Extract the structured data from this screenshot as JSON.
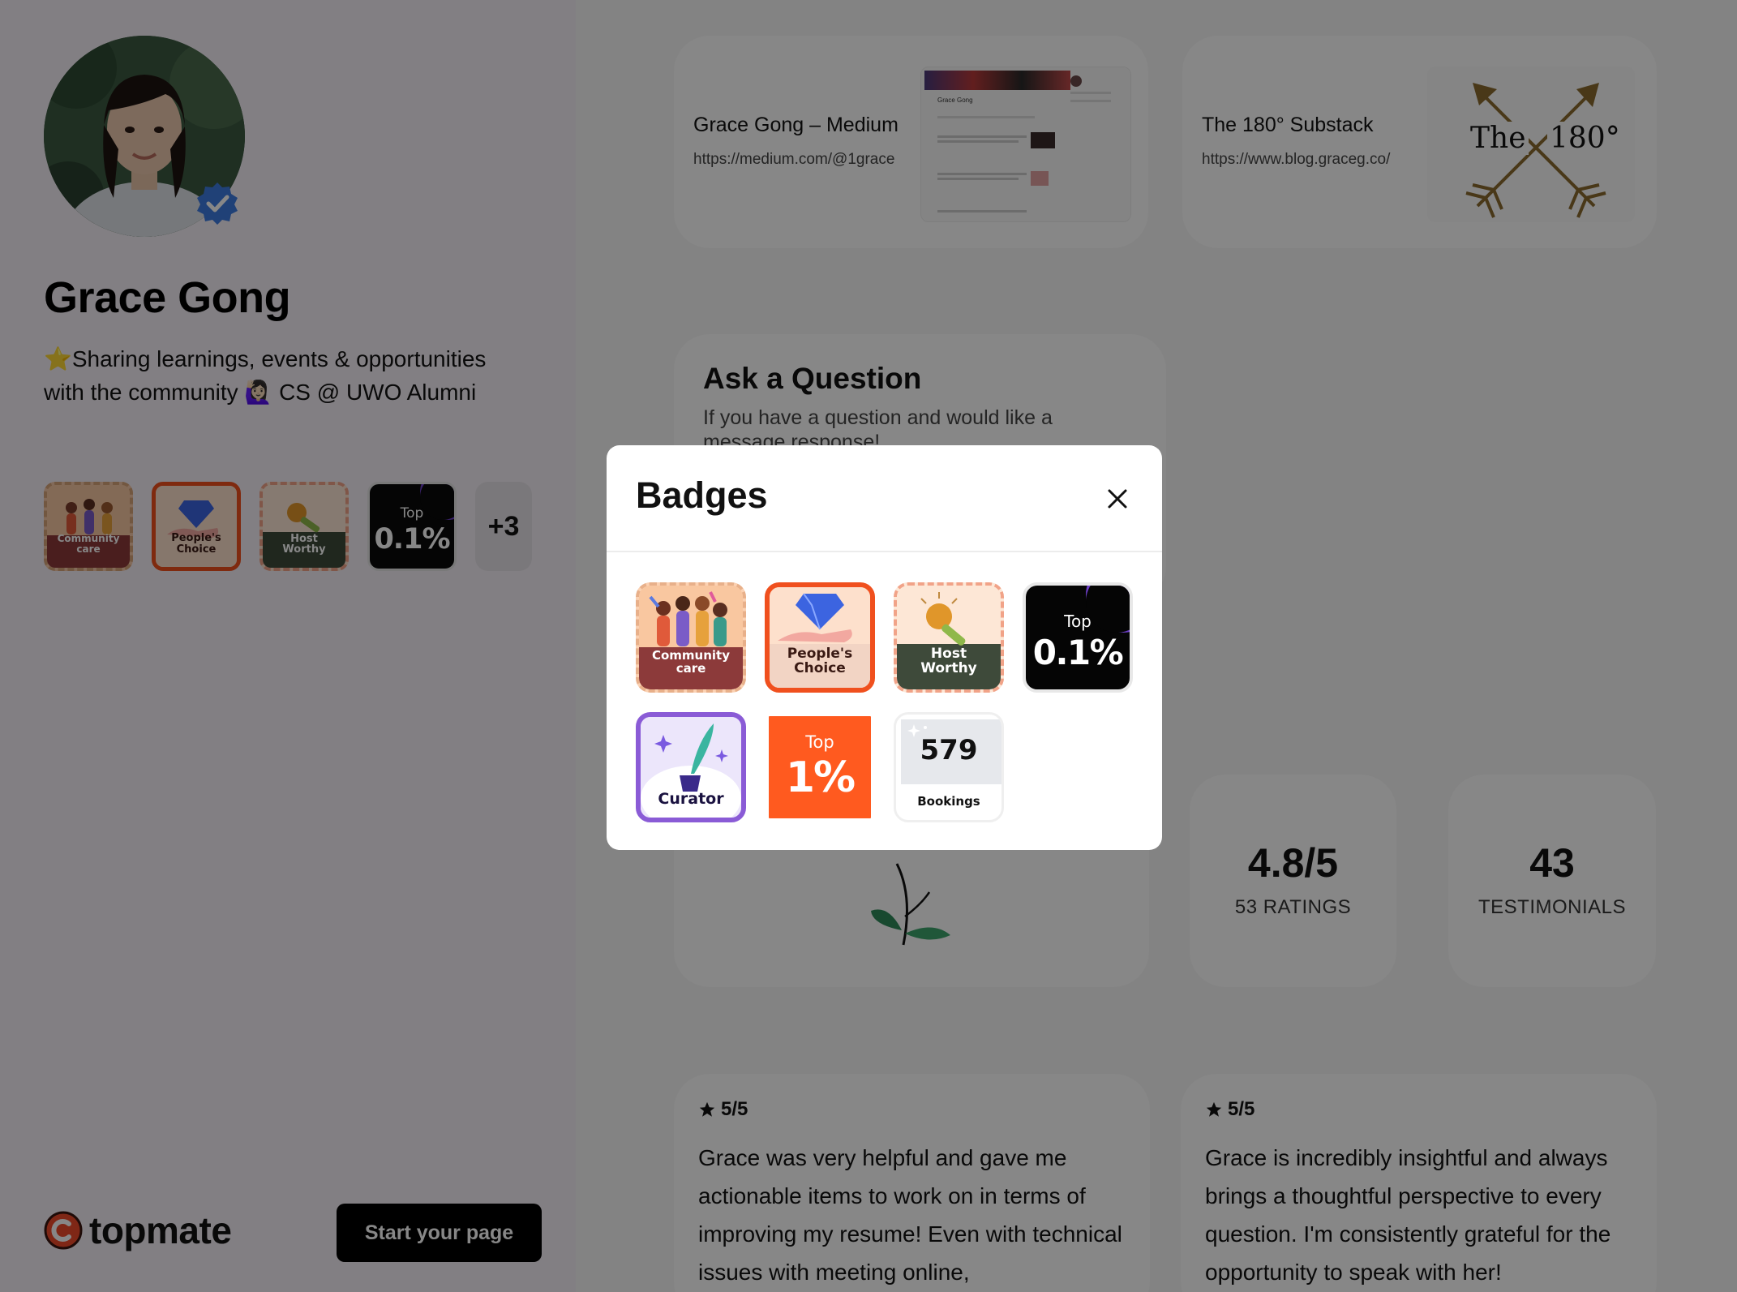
{
  "profile": {
    "name": "Grace Gong",
    "bio": "Sharing learnings, events & opportunities with the community 🙋🏻‍♀️ CS @ UWO Alumni",
    "bio_emoji": "⭐",
    "verified": true
  },
  "sidebar_badges": [
    {
      "label": "Community care"
    },
    {
      "label": "People's Choice"
    },
    {
      "label": "Host Worthy"
    },
    {
      "top": "Top",
      "value": "0.1%"
    }
  ],
  "more_badges": "+3",
  "brand": {
    "name": "topmate"
  },
  "cta": {
    "label": "Start your page"
  },
  "links": [
    {
      "title": "Grace Gong – Medium",
      "url": "https://medium.com/@1grace",
      "thumb_title": "Grace Gong"
    },
    {
      "title": "The 180° Substack",
      "url": "https://www.blog.graceg.co/",
      "thumb_logo_left": "The",
      "thumb_logo_right": "180°"
    }
  ],
  "ask": {
    "title": "Ask a Question",
    "desc": "If you have a question and would like a message response!"
  },
  "stats": [
    {
      "value": "4.8/5",
      "label": "53 RATINGS"
    },
    {
      "value": "43",
      "label": "TESTIMONIALS"
    }
  ],
  "reviews": [
    {
      "rating": "5/5",
      "text": "Grace was very helpful and gave me actionable items to work on in terms of improving my resume! Even with technical issues with meeting online,"
    },
    {
      "rating": "5/5",
      "text": "Grace is incredibly insightful and always brings a thoughtful perspective to every question. I'm consistently grateful for the opportunity to speak with her!"
    }
  ],
  "modal": {
    "title": "Badges",
    "badges": [
      {
        "line1": "Community",
        "line2": "care"
      },
      {
        "line1": "People's",
        "line2": "Choice"
      },
      {
        "line1": "Host",
        "line2": "Worthy"
      },
      {
        "top": "Top",
        "value": "0.1%"
      },
      {
        "line1": "Curator"
      },
      {
        "top": "Top",
        "value": "1%"
      },
      {
        "value": "579",
        "label": "Bookings"
      }
    ]
  },
  "colors": {
    "overlay": "rgba(0,0,0,0.47)",
    "orange": "#ff5a1f",
    "purple": "#8a5bd6",
    "sidebar_bg": "#f6f0f7"
  }
}
